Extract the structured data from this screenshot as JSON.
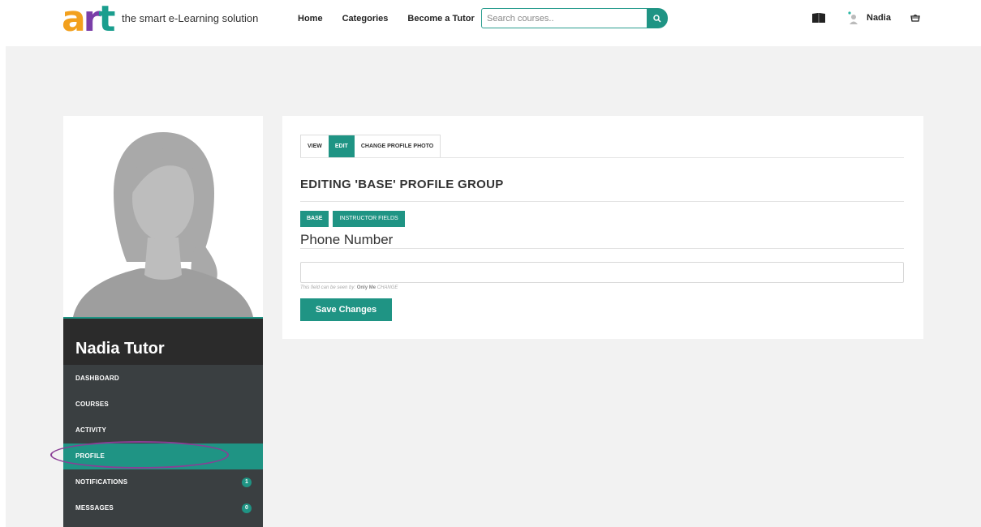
{
  "header": {
    "logo": {
      "a": "a",
      "r": "r",
      "t": "t"
    },
    "tagline": "the smart e-Learning solution",
    "nav": [
      "Home",
      "Categories",
      "Become a Tutor"
    ],
    "search_placeholder": "Search courses..",
    "user_name": "Nadia"
  },
  "profile": {
    "name": "Nadia Tutor",
    "menu": [
      {
        "label": "DASHBOARD"
      },
      {
        "label": "COURSES"
      },
      {
        "label": "ACTIVITY"
      },
      {
        "label": "PROFILE",
        "active": true
      },
      {
        "label": "NOTIFICATIONS",
        "badge": "1"
      },
      {
        "label": "MESSAGES",
        "badge": "0"
      }
    ]
  },
  "main": {
    "tabs": [
      "VIEW",
      "EDIT",
      "CHANGE PROFILE PHOTO"
    ],
    "active_tab": "EDIT",
    "heading": "EDITING 'BASE' PROFILE GROUP",
    "groups": [
      "BASE",
      "INSTRUCTOR FIELDS"
    ],
    "field_label": "Phone Number",
    "phone_value": "",
    "visibility_prefix": "This field can be seen by:",
    "visibility_value": "Only Me",
    "visibility_change": "CHANGE",
    "save_label": "Save Changes"
  },
  "colors": {
    "accent": "#1f9484",
    "logo_a": "#f2a01d",
    "logo_r": "#7a3ea8",
    "logo_t": "#1a9e8e",
    "annotation": "#8a3e96"
  },
  "icons": [
    "search-icon",
    "book-icon",
    "user-avatar-icon",
    "basket-icon"
  ]
}
